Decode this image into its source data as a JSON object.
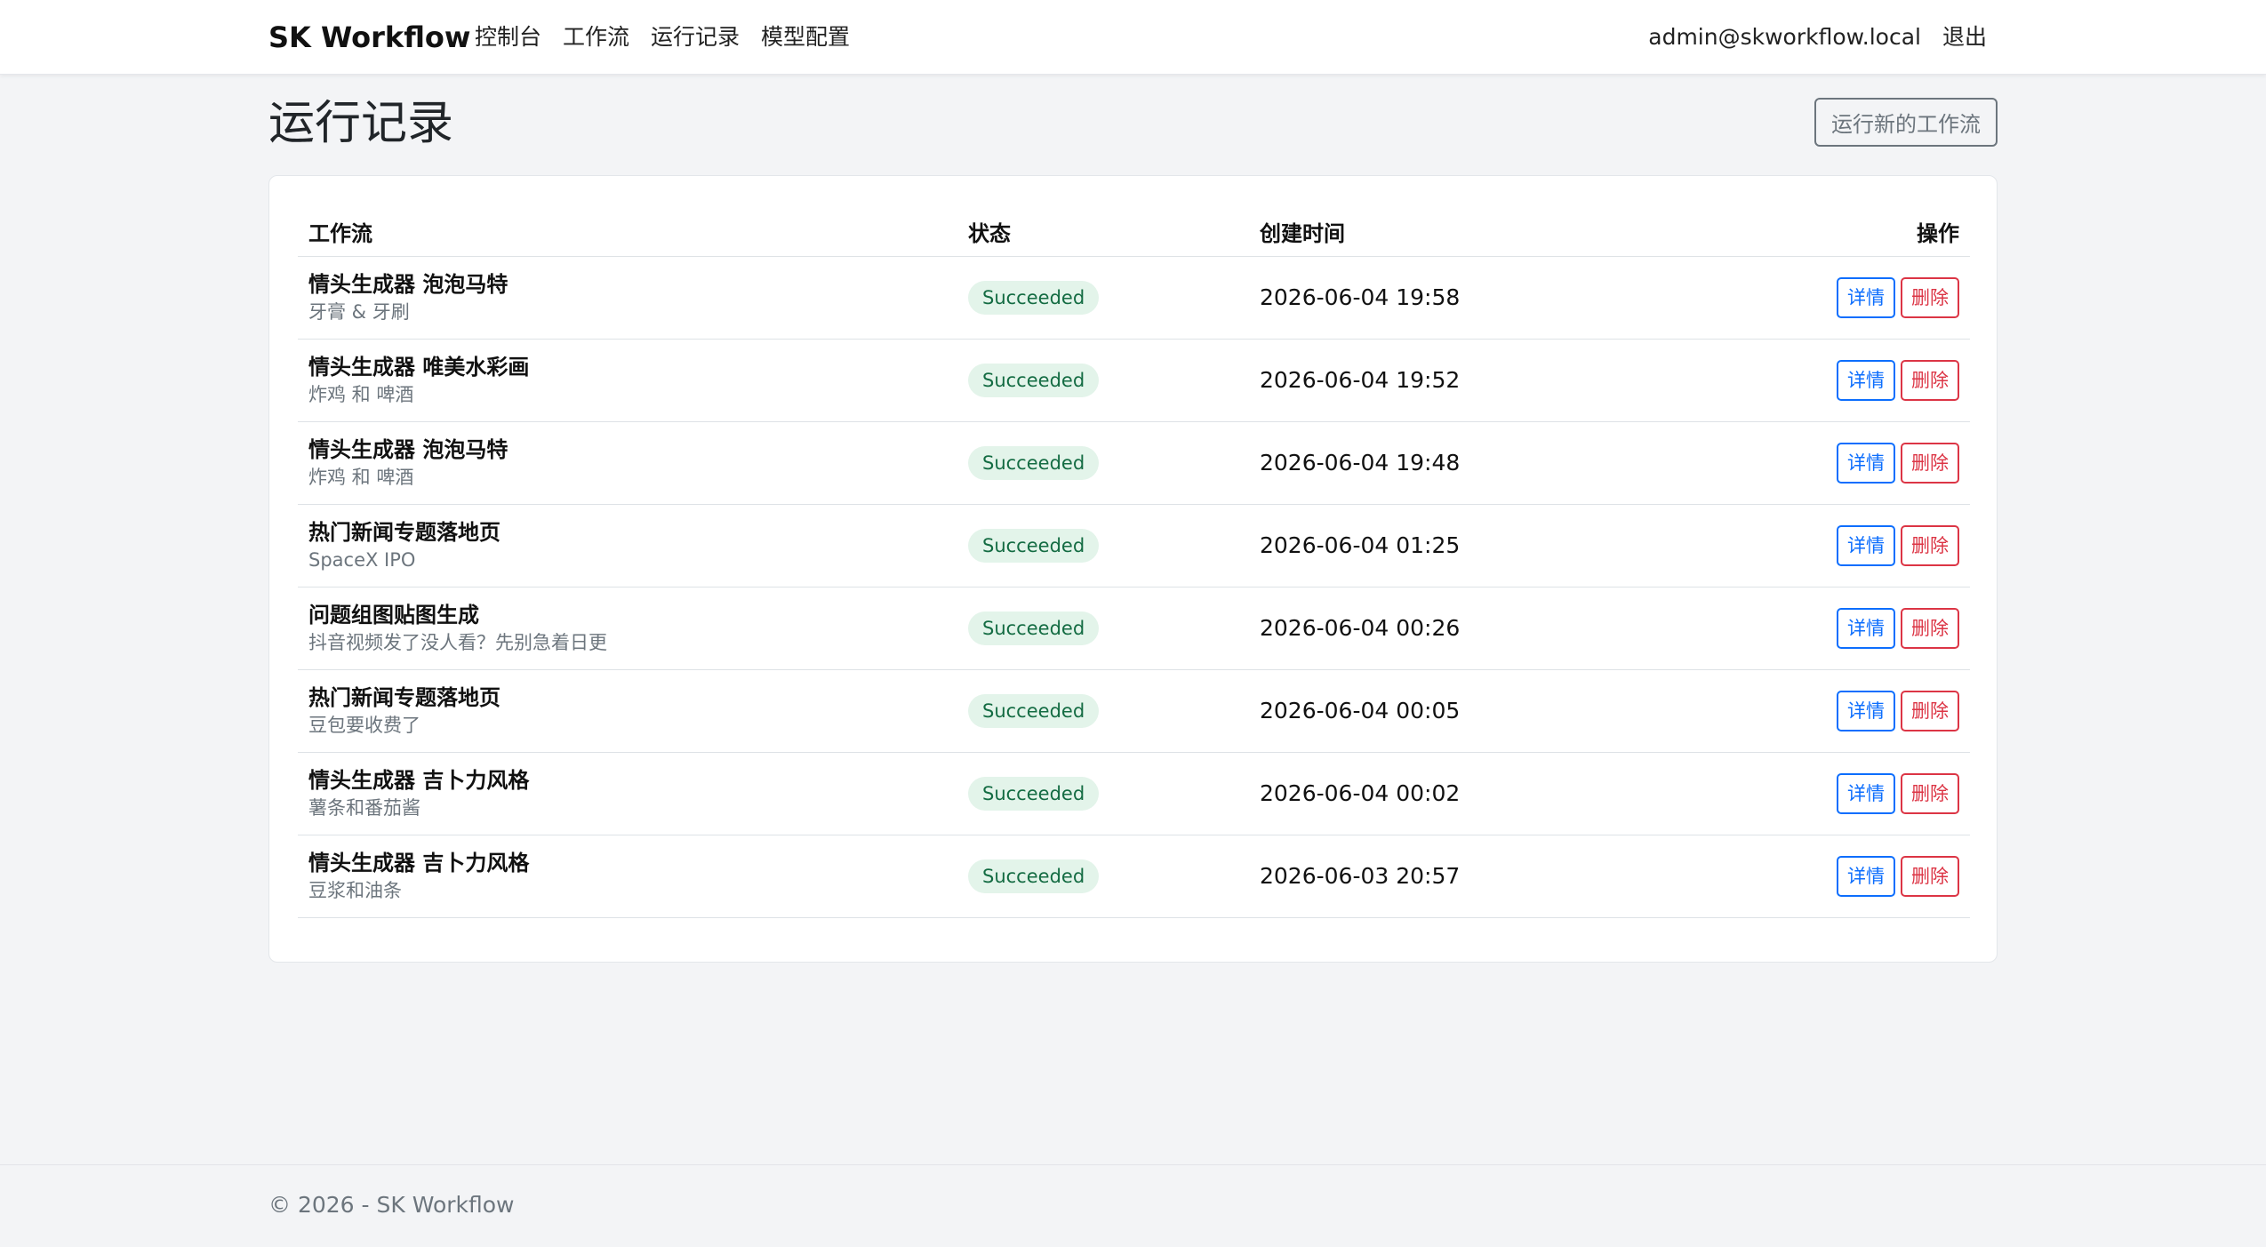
{
  "navbar": {
    "brand": "SK Workflow",
    "links": [
      "控制台",
      "工作流",
      "运行记录",
      "模型配置"
    ],
    "user_email": "admin@skworkflow.local",
    "logout": "退出"
  },
  "page": {
    "title": "运行记录",
    "run_new_button": "运行新的工作流"
  },
  "table": {
    "headers": {
      "workflow": "工作流",
      "status": "状态",
      "created": "创建时间",
      "actions": "操作"
    },
    "detail_label": "详情",
    "delete_label": "删除",
    "rows": [
      {
        "name": "情头生成器 泡泡马特",
        "subtitle": "牙膏 & 牙刷",
        "status": "Succeeded",
        "created": "2026-06-04 19:58"
      },
      {
        "name": "情头生成器 唯美水彩画",
        "subtitle": "炸鸡 和 啤酒",
        "status": "Succeeded",
        "created": "2026-06-04 19:52"
      },
      {
        "name": "情头生成器 泡泡马特",
        "subtitle": "炸鸡 和 啤酒",
        "status": "Succeeded",
        "created": "2026-06-04 19:48"
      },
      {
        "name": "热门新闻专题落地页",
        "subtitle": "SpaceX IPO",
        "status": "Succeeded",
        "created": "2026-06-04 01:25"
      },
      {
        "name": "问题组图贴图生成",
        "subtitle": "抖音视频发了没人看？先别急着日更",
        "status": "Succeeded",
        "created": "2026-06-04 00:26"
      },
      {
        "name": "热门新闻专题落地页",
        "subtitle": "豆包要收费了",
        "status": "Succeeded",
        "created": "2026-06-04 00:05"
      },
      {
        "name": "情头生成器 吉卜力风格",
        "subtitle": "薯条和番茄酱",
        "status": "Succeeded",
        "created": "2026-06-04 00:02"
      },
      {
        "name": "情头生成器 吉卜力风格",
        "subtitle": "豆浆和油条",
        "status": "Succeeded",
        "created": "2026-06-03 20:57"
      }
    ]
  },
  "footer": {
    "text": "© 2026 - SK Workflow"
  },
  "colors": {
    "primary": "#0d6efd",
    "danger": "#dc3545",
    "success_bg": "#e3f4ea",
    "success_text": "#146c43"
  }
}
